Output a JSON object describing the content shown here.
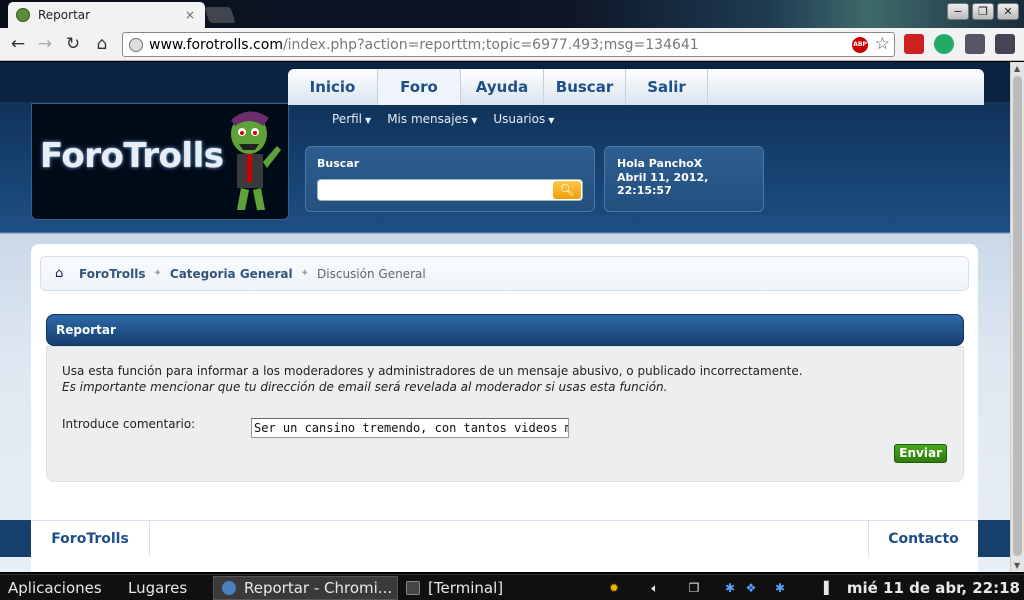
{
  "browser": {
    "tab_title": "Reportar",
    "tab_close": "×",
    "url_host": "www.forotrolls.com",
    "url_path": "/index.php?action=reporttm;topic=6977.493;msg=134641",
    "abp_label": "ABP",
    "window_buttons": [
      "−",
      "❐",
      "✕"
    ]
  },
  "site": {
    "logo_text": "ForoTrolls",
    "nav": [
      {
        "label": "Inicio",
        "width": 90
      },
      {
        "label": "Foro",
        "width": 83
      },
      {
        "label": "Ayuda",
        "width": 83
      },
      {
        "label": "Buscar",
        "width": 82
      },
      {
        "label": "Salir",
        "width": 82
      }
    ],
    "subnav": [
      "Perfil",
      "Mis mensajes",
      "Usuarios"
    ],
    "search_label": "Buscar",
    "user_greeting": "Hola PanchoX",
    "user_date": "Abril 11, 2012, 22:15:57"
  },
  "breadcrumb": {
    "items": [
      "ForoTrolls",
      "Categoria General"
    ],
    "current": "Discusión General"
  },
  "report": {
    "title": "Reportar",
    "line1": "Usa esta función para informar a los moderadores y administradores de un mensaje abusivo, o publicado incorrectamente.",
    "line2": "Es importante mencionar que tu dirección de email será revelada al moderador si usas esta función.",
    "comment_label": "Introduce comentario:",
    "comment_value": "Ser un cansino tremendo, con tantos videos me peta",
    "submit_label": "Enviar"
  },
  "footer": {
    "left": "ForoTrolls",
    "right": "Contacto"
  },
  "taskbar": {
    "menu_apps": "Aplicaciones",
    "menu_places": "Lugares",
    "task1": "Reportar - Chromi...",
    "task2": "[Terminal]",
    "clock": "mié 11 de abr, 22:18"
  },
  "colors": {
    "accent": "#1f4f8a",
    "header_dark": "#0e2a4c",
    "send_green": "#2d7d0c"
  }
}
